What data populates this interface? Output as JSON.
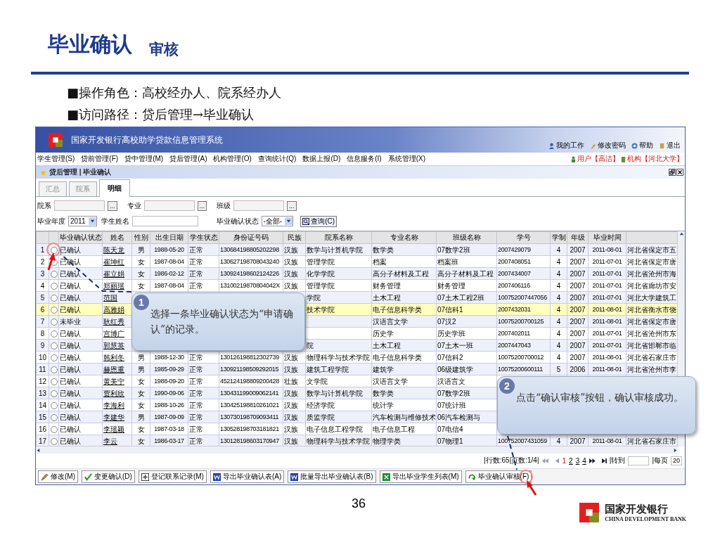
{
  "slide": {
    "title": "毕业确认",
    "subtitle": "审核",
    "bullets": [
      "■操作角色：高校经办人、院系经办人",
      "■访问路径：贷后管理→毕业确认"
    ],
    "page_number": "36",
    "logo": {
      "name": "国家开发银行",
      "english": "CHINA DEVELOPMENT BANK"
    }
  },
  "app": {
    "title": "国家开发银行高校助学贷款信息管理系统",
    "top_links": [
      {
        "label": "我的工作",
        "kind": "work"
      },
      {
        "label": "修改密码",
        "kind": "password"
      },
      {
        "label": "帮助",
        "kind": "help"
      },
      {
        "label": "退出",
        "kind": "exit"
      }
    ],
    "menu": [
      "学生管理(S)",
      "贷前管理(F)",
      "贷中管理(M)",
      "贷后管理(A)",
      "机构管理(O)",
      "查询统计(Q)",
      "数据上报(D)",
      "信息服务(I)",
      "系统管理(X)"
    ],
    "user": "用户【高洁】",
    "org": "机构【河北大学】",
    "breadcrumb": "贷后管理 | 毕业确认",
    "tabs": [
      {
        "label": "汇总",
        "selected": false
      },
      {
        "label": "院系",
        "selected": false
      },
      {
        "label": "明细",
        "selected": true
      }
    ],
    "filter_rows": [
      [
        {
          "label": "院系",
          "kind": "picker",
          "button": "..."
        },
        {
          "label": "专业",
          "kind": "picker",
          "button": "..."
        },
        {
          "label": "班级",
          "kind": "picker",
          "button": "..."
        }
      ],
      [
        {
          "label": "毕业年度",
          "kind": "select",
          "value": "2011"
        },
        {
          "label": "学生姓名",
          "kind": "text"
        },
        {
          "label": "毕业确认状态",
          "kind": "select",
          "value": "-全部-"
        },
        {
          "label": "查询(C)",
          "kind": "button"
        }
      ]
    ],
    "table": {
      "columns": [
        "毕业确认状态",
        "姓名",
        "性别",
        "出生日期",
        "学生状态",
        "身份证号码",
        "民族",
        "院系名称",
        "专业名称",
        "班级名称",
        "学号",
        "学制",
        "年级",
        "毕业时间"
      ],
      "rows": [
        {
          "no": "1",
          "selected": false,
          "cells": [
            "已确认",
            "陈天龙",
            "男",
            "1988-05-20",
            "正常",
            "130684198805202298",
            "汉族",
            "数学与计算机学院",
            "数学类",
            "07数学2班",
            "2007429079",
            "4",
            "2007",
            "2011-08-01",
            "河北省保定市五"
          ]
        },
        {
          "no": "2",
          "selected": false,
          "cells": [
            "已确认",
            "崔坤红",
            "女",
            "1987-08-04",
            "正常",
            "130627198708043240",
            "汉族",
            "管理学院",
            "档案",
            "档案班",
            "2007408051",
            "4",
            "2007",
            "2011-07-01",
            "河北省保定市唐"
          ]
        },
        {
          "no": "3",
          "selected": false,
          "cells": [
            "已确认",
            "崔立娟",
            "女",
            "1986-02-12",
            "正常",
            "130924198602124226",
            "汉族",
            "化学学院",
            "高分子材料及工程",
            "高分子材料及工程",
            "2007434007",
            "4",
            "2007",
            "2011-07-01",
            "河北省沧州市海"
          ]
        },
        {
          "no": "4",
          "selected": false,
          "cells": [
            "已确认",
            "郑丽瑶",
            "女",
            "1987-08-04",
            "正常",
            "13100219870804042X",
            "汉族",
            "管理学院",
            "财务管理",
            "财务管理",
            "2007406116",
            "4",
            "2007",
            "2011-07-01",
            "河北省廊坊市安"
          ]
        },
        {
          "no": "5",
          "selected": false,
          "cells": [
            "已确认",
            "范国",
            null,
            null,
            null,
            null,
            null,
            "学院",
            "土木工程",
            "07土木工程2班",
            "100752007447056",
            "4",
            "2007",
            "2011-07-01",
            "河北大学建筑工"
          ]
        },
        {
          "no": "6",
          "selected": true,
          "cells": [
            "已确认",
            "高雅娟",
            null,
            null,
            null,
            null,
            null,
            "技术学院",
            "电子信息科学类",
            "07信科1",
            "2007432031",
            "4",
            "2007",
            "2011-08-01",
            "河北省衡水市饶"
          ]
        },
        {
          "no": "7",
          "selected": false,
          "cells": [
            "未毕业",
            "耿红秀",
            null,
            null,
            null,
            null,
            null,
            null,
            "汉语言文学",
            "07汉2",
            "10075200700125",
            "4",
            "2007",
            "2011-08-01",
            "河北省保定市唐"
          ]
        },
        {
          "no": "8",
          "selected": false,
          "cells": [
            "已确认",
            "宫博广",
            null,
            null,
            null,
            null,
            null,
            null,
            "历史学",
            "历史学班",
            "2007402011",
            "4",
            "2007",
            "2011-07-01",
            "河北省沧州市东"
          ]
        },
        {
          "no": "9",
          "selected": false,
          "cells": [
            "已确认",
            "郭慧英",
            null,
            null,
            null,
            null,
            null,
            "院",
            "土木工程",
            "07土木一班",
            "2007447043",
            "4",
            "2007",
            "2011-07-01",
            "河北省邯郸市临"
          ]
        },
        {
          "no": "10",
          "selected": false,
          "cells": [
            "已确认",
            "韩利冬",
            "男",
            "1988-12-30",
            "正常",
            "130126198812302739",
            "汉族",
            "物理科学与技术学院",
            "电子信息科学类",
            "07信科2",
            "10075200700012",
            "4",
            "2007",
            "2011-08-01",
            "河北省石家庄市"
          ]
        },
        {
          "no": "11",
          "selected": false,
          "cells": [
            "已确认",
            "赫恩重",
            "男",
            "1985-09-29",
            "正常",
            "130921198509292015",
            "汉族",
            "建筑工程学院",
            "建筑学",
            "06级建筑学",
            "10075200600111",
            "5",
            "2006",
            "2011-08-01",
            "河北省沧州市李"
          ]
        },
        {
          "no": "12",
          "selected": false,
          "cells": [
            "已确认",
            "黄美宁",
            "女",
            "1988-09-20",
            "正常",
            "452124198809200428",
            "壮族",
            "文学院",
            "汉语言文学",
            "汉语言文",
            null,
            null,
            null,
            null,
            null
          ]
        },
        {
          "no": "13",
          "selected": false,
          "cells": [
            "已确认",
            "贾利欣",
            "女",
            "1990-09-06",
            "正常",
            "130431199009062141",
            "汉族",
            "数学与计算机学院",
            "数学类",
            "07数学2班",
            null,
            null,
            null,
            null,
            null
          ]
        },
        {
          "no": "14",
          "selected": false,
          "cells": [
            "已确认",
            "李海利",
            "女",
            "1988-10-26",
            "正常",
            "130425198810261021",
            "汉族",
            "经济学院",
            "统计学",
            "07统计班",
            null,
            null,
            null,
            null,
            null
          ]
        },
        {
          "no": "15",
          "selected": false,
          "cells": [
            "已确认",
            "李建华",
            "男",
            "1987-09-09",
            "正常",
            "130730198709093411",
            "汉族",
            "质监学院",
            "汽车检测与维修技术",
            "06汽车检测与",
            null,
            null,
            null,
            null,
            null
          ]
        },
        {
          "no": "16",
          "selected": false,
          "cells": [
            "已确认",
            "李瑶颖",
            "女",
            "1987-03-18",
            "正常",
            "130528198703181821",
            "汉族",
            "电子信息工程学院",
            "电子信息工程",
            "07电信4",
            null,
            null,
            null,
            null,
            null
          ]
        },
        {
          "no": "17",
          "selected": false,
          "cells": [
            "已确认",
            "李云",
            "女",
            "1986-03-17",
            "正常",
            "130128198603170947",
            "汉族",
            "物理科学与技术学院",
            "物理学类",
            "07物理1",
            "100752007431059",
            "4",
            "2007",
            "2011-08-01",
            "河北省石家庄市"
          ]
        }
      ]
    },
    "pager": {
      "summary": "|行数:65|页数:1/4|",
      "pages": [
        {
          "label": "1",
          "selected": true
        },
        {
          "label": "2",
          "selected": false
        },
        {
          "label": "3",
          "selected": false
        },
        {
          "label": "4",
          "selected": false
        }
      ],
      "goto": "|转到",
      "per_page_label": "|每页",
      "per_page": "20"
    },
    "toolbar": [
      {
        "label": "修改(M)",
        "kind": "edit"
      },
      {
        "label": "变更确认(D)",
        "kind": "confirm"
      },
      {
        "label": "登记联系记录(M)",
        "kind": "add"
      },
      {
        "label": "导出毕业确认表(A)",
        "kind": "word"
      },
      {
        "label": "批量导出毕业确认表(B)",
        "kind": "word"
      },
      {
        "label": "导出毕业学生列表(M)",
        "kind": "excel"
      },
      {
        "label": "毕业确认审核(F)",
        "kind": "audit"
      }
    ]
  },
  "callouts": [
    {
      "number": "1",
      "text": "选择一条毕业确认状态为“申请确认”的记录。"
    },
    {
      "number": "2",
      "text": "点击“确认审核”按钮，确认审核成功。"
    }
  ]
}
